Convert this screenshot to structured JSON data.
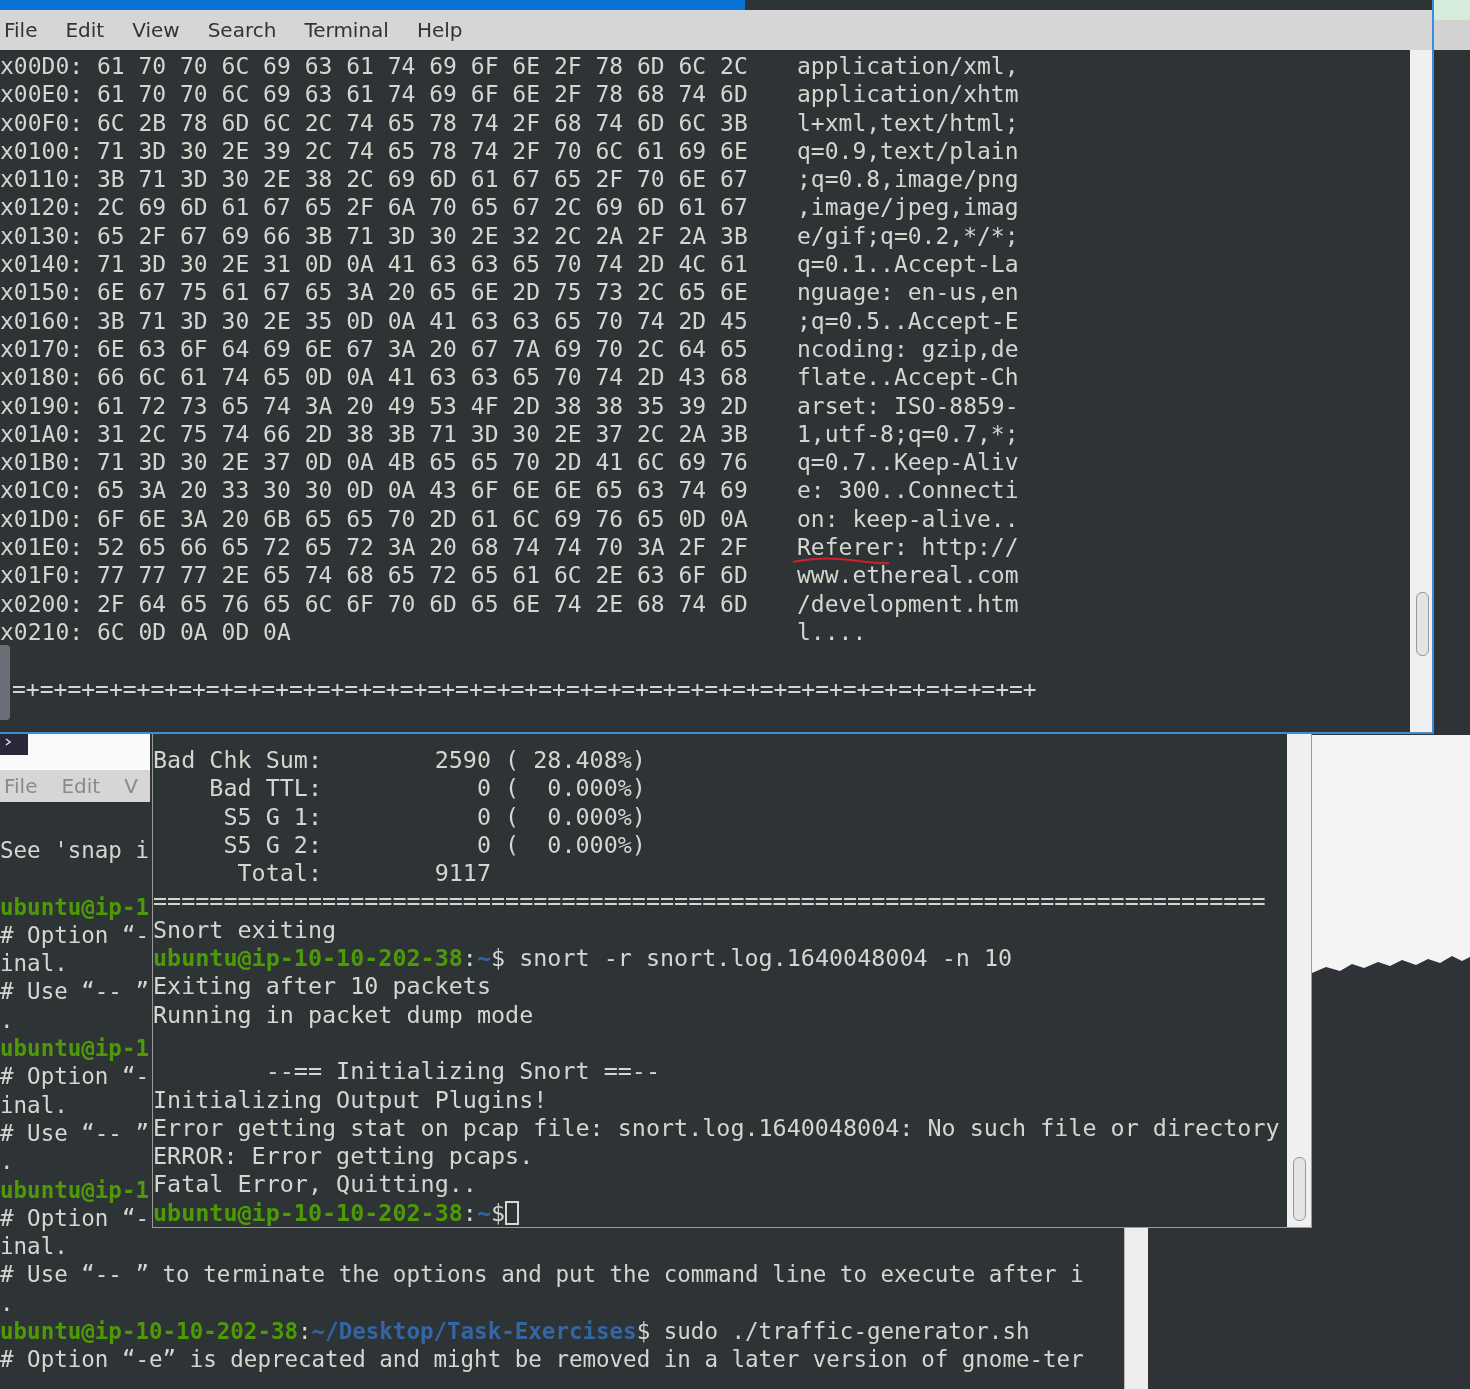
{
  "back_terminal": {
    "menu": [
      "File",
      "Edit",
      "V"
    ],
    "lines": [
      {
        "kind": "text",
        "text": "See 'snap i"
      },
      {
        "kind": "gap"
      },
      {
        "kind": "prompt",
        "user": "ubuntu@ip-1"
      },
      {
        "kind": "text",
        "text": "# Option “-"
      },
      {
        "kind": "text",
        "text": "inal."
      },
      {
        "kind": "text",
        "text": "# Use “-- ”"
      },
      {
        "kind": "text",
        "text": "."
      },
      {
        "kind": "prompt",
        "user": "ubuntu@ip-1"
      },
      {
        "kind": "text",
        "text": "# Option “-"
      },
      {
        "kind": "text",
        "text": "inal."
      },
      {
        "kind": "text",
        "text": "# Use “-- ”"
      },
      {
        "kind": "text",
        "text": "."
      },
      {
        "kind": "prompt",
        "user": "ubuntu@ip-1"
      },
      {
        "kind": "text",
        "text": "# Option “-"
      },
      {
        "kind": "text",
        "text": "inal."
      },
      {
        "kind": "text",
        "text": "# Use “-- ” to terminate the options and put the command line to execute after i"
      },
      {
        "kind": "text",
        "text": "."
      },
      {
        "kind": "prompt",
        "user": "ubuntu@ip-10-10-202-38",
        "separator": ":",
        "path": "~/Desktop/Task-Exercises",
        "command": "$ sudo ./traffic-generator.sh"
      },
      {
        "kind": "text",
        "text": "# Option “-e” is deprecated and might be removed in a later version of gnome-ter"
      }
    ]
  },
  "hex_terminal": {
    "menu": [
      "File",
      "Edit",
      "View",
      "Search",
      "Terminal",
      "Help"
    ],
    "rows": [
      {
        "hex": "x00D0: 61 70 70 6C 69 63 61 74 69 6F 6E 2F 78 6D 6C 2C",
        "ascii": "application/xml,",
        "underlined": false
      },
      {
        "hex": "x00E0: 61 70 70 6C 69 63 61 74 69 6F 6E 2F 78 68 74 6D",
        "ascii": "application/xhtm",
        "underlined": false
      },
      {
        "hex": "x00F0: 6C 2B 78 6D 6C 2C 74 65 78 74 2F 68 74 6D 6C 3B",
        "ascii": "l+xml,text/html;",
        "underlined": false
      },
      {
        "hex": "x0100: 71 3D 30 2E 39 2C 74 65 78 74 2F 70 6C 61 69 6E",
        "ascii": "q=0.9,text/plain",
        "underlined": false
      },
      {
        "hex": "x0110: 3B 71 3D 30 2E 38 2C 69 6D 61 67 65 2F 70 6E 67",
        "ascii": ";q=0.8,image/png",
        "underlined": false
      },
      {
        "hex": "x0120: 2C 69 6D 61 67 65 2F 6A 70 65 67 2C 69 6D 61 67",
        "ascii": ",image/jpeg,imag",
        "underlined": false
      },
      {
        "hex": "x0130: 65 2F 67 69 66 3B 71 3D 30 2E 32 2C 2A 2F 2A 3B",
        "ascii": "e/gif;q=0.2,*/*;",
        "underlined": false
      },
      {
        "hex": "x0140: 71 3D 30 2E 31 0D 0A 41 63 63 65 70 74 2D 4C 61",
        "ascii": "q=0.1..Accept-La",
        "underlined": false
      },
      {
        "hex": "x0150: 6E 67 75 61 67 65 3A 20 65 6E 2D 75 73 2C 65 6E",
        "ascii": "nguage: en-us,en",
        "underlined": false
      },
      {
        "hex": "x0160: 3B 71 3D 30 2E 35 0D 0A 41 63 63 65 70 74 2D 45",
        "ascii": ";q=0.5..Accept-E",
        "underlined": false
      },
      {
        "hex": "x0170: 6E 63 6F 64 69 6E 67 3A 20 67 7A 69 70 2C 64 65",
        "ascii": "ncoding: gzip,de",
        "underlined": false
      },
      {
        "hex": "x0180: 66 6C 61 74 65 0D 0A 41 63 63 65 70 74 2D 43 68",
        "ascii": "flate..Accept-Ch",
        "underlined": false
      },
      {
        "hex": "x0190: 61 72 73 65 74 3A 20 49 53 4F 2D 38 38 35 39 2D",
        "ascii": "arset: ISO-8859-",
        "underlined": false
      },
      {
        "hex": "x01A0: 31 2C 75 74 66 2D 38 3B 71 3D 30 2E 37 2C 2A 3B",
        "ascii": "1,utf-8;q=0.7,*;",
        "underlined": false
      },
      {
        "hex": "x01B0: 71 3D 30 2E 37 0D 0A 4B 65 65 70 2D 41 6C 69 76",
        "ascii": "q=0.7..Keep-Aliv",
        "underlined": false
      },
      {
        "hex": "x01C0: 65 3A 20 33 30 30 0D 0A 43 6F 6E 6E 65 63 74 69",
        "ascii": "e: 300..Connecti",
        "underlined": false
      },
      {
        "hex": "x01D0: 6F 6E 3A 20 6B 65 65 70 2D 61 6C 69 76 65 0D 0A",
        "ascii": "on: keep-alive..",
        "underlined": false
      },
      {
        "hex": "x01E0: 52 65 66 65 72 65 72 3A 20 68 74 74 70 3A 2F 2F",
        "ascii": "Referer: http://",
        "underlined": true
      },
      {
        "hex": "x01F0: 77 77 77 2E 65 74 68 65 72 65 61 6C 2E 63 6F 6D",
        "ascii": "www.ethereal.com",
        "underlined": false
      },
      {
        "hex": "x0200: 2F 64 65 76 65 6C 6F 70 6D 65 6E 74 2E 68 74 6D",
        "ascii": "/development.htm",
        "underlined": false
      },
      {
        "hex": "x0210: 6C 0D 0A 0D 0A",
        "ascii": "l....",
        "underlined": false
      }
    ],
    "separator": "=+=+=+=+=+=+=+=+=+=+=+=+=+=+=+=+=+=+=+=+=+=+=+=+=+=+=+=+=+=+=+=+=+=+=+=+=+"
  },
  "output_terminal": {
    "lines": [
      {
        "kind": "text",
        "text": "Bad Chk Sum:        2590 ( 28.408%)"
      },
      {
        "kind": "text",
        "text": "    Bad TTL:           0 (  0.000%)"
      },
      {
        "kind": "text",
        "text": "     S5 G 1:           0 (  0.000%)"
      },
      {
        "kind": "text",
        "text": "     S5 G 2:           0 (  0.000%)"
      },
      {
        "kind": "text",
        "text": "      Total:        9117"
      },
      {
        "kind": "text",
        "text": "==============================================================================="
      },
      {
        "kind": "text",
        "text": "Snort exiting"
      },
      {
        "kind": "prompt",
        "user": "ubuntu@ip-10-10-202-38",
        "separator": ":",
        "path": "~",
        "command": "$ snort -r snort.log.1640048004 -n 10",
        "cursor": false
      },
      {
        "kind": "text",
        "text": "Exiting after 10 packets"
      },
      {
        "kind": "text",
        "text": "Running in packet dump mode"
      },
      {
        "kind": "gap"
      },
      {
        "kind": "text",
        "text": "        --== Initializing Snort ==--"
      },
      {
        "kind": "text",
        "text": "Initializing Output Plugins!"
      },
      {
        "kind": "text",
        "text": "Error getting stat on pcap file: snort.log.1640048004: No such file or directory"
      },
      {
        "kind": "text",
        "text": "ERROR: Error getting pcaps."
      },
      {
        "kind": "text",
        "text": "Fatal Error, Quitting.."
      },
      {
        "kind": "prompt",
        "user": "ubuntu@ip-10-10-202-38",
        "separator": ":",
        "path": "~",
        "command": "$",
        "cursor": true
      }
    ]
  }
}
